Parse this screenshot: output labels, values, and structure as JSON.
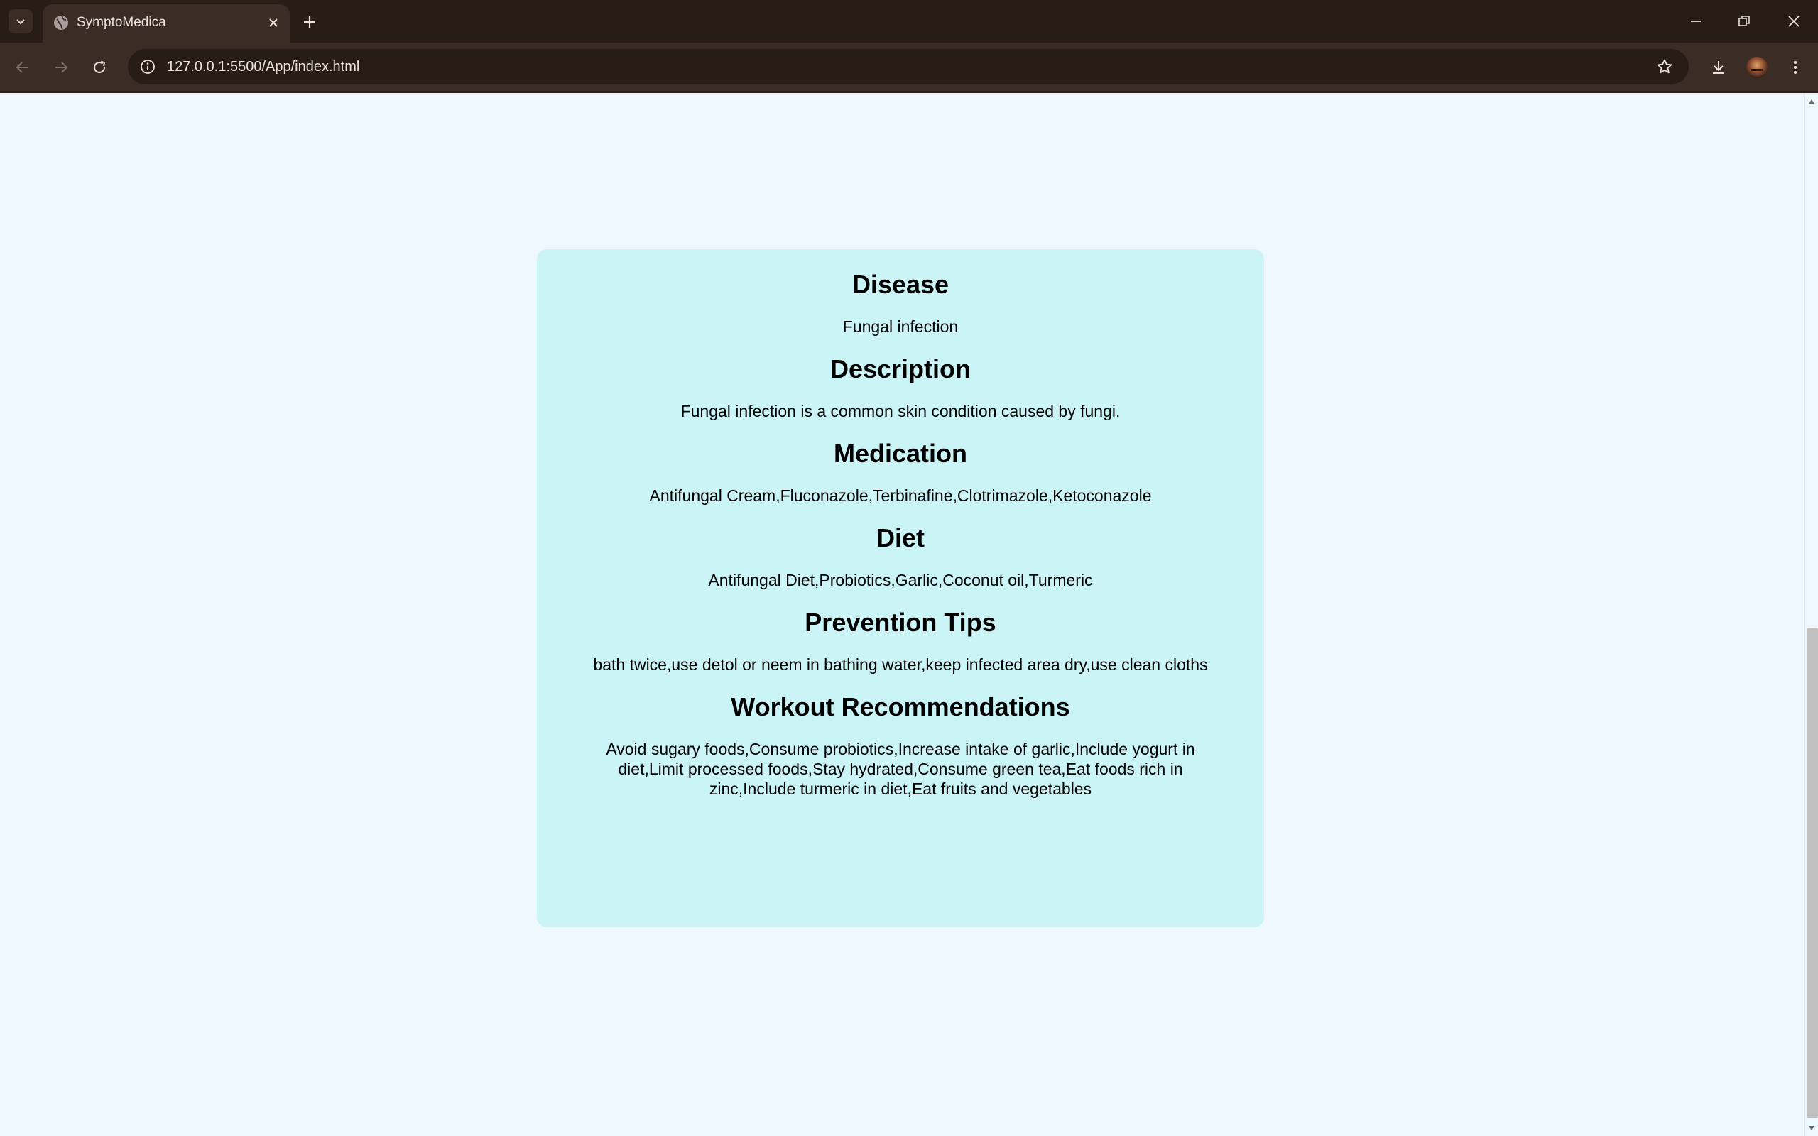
{
  "browser": {
    "tab_title": "SymptoMedica",
    "url": "127.0.0.1:5500/App/index.html"
  },
  "result": {
    "sections": [
      {
        "heading": "Disease",
        "body": "Fungal infection"
      },
      {
        "heading": "Description",
        "body": "Fungal infection is a common skin condition caused by fungi."
      },
      {
        "heading": "Medication",
        "body": "Antifungal Cream,Fluconazole,Terbinafine,Clotrimazole,Ketoconazole"
      },
      {
        "heading": "Diet",
        "body": "Antifungal Diet,Probiotics,Garlic,Coconut oil,Turmeric"
      },
      {
        "heading": "Prevention Tips",
        "body": "bath twice,use detol or neem in bathing water,keep infected area dry,use clean cloths"
      },
      {
        "heading": "Workout Recommendations",
        "body": "Avoid sugary foods,Consume probiotics,Increase intake of garlic,Include yogurt in diet,Limit processed foods,Stay hydrated,Consume green tea,Eat foods rich in zinc,Include turmeric in diet,Eat fruits and vegetables"
      }
    ]
  },
  "colors": {
    "chrome_dark": "#281c17",
    "chrome_toolbar": "#3b2c25",
    "page_background": "#eff7ff",
    "card_background": "#caf4f6",
    "scroll_thumb": "#c1c1c1"
  },
  "icons": {
    "tab_search": "chevron-down-icon",
    "favicon": "globe-icon",
    "tab_close": "close-icon",
    "new_tab": "plus-icon",
    "minimize": "minimize-icon",
    "restore": "restore-icon",
    "close_window": "close-icon",
    "back": "arrow-left-icon",
    "forward": "arrow-right-icon",
    "reload": "reload-icon",
    "site_info": "info-icon",
    "bookmark": "star-icon",
    "downloads": "download-icon",
    "profile": "avatar",
    "menu": "kebab-menu-icon"
  }
}
